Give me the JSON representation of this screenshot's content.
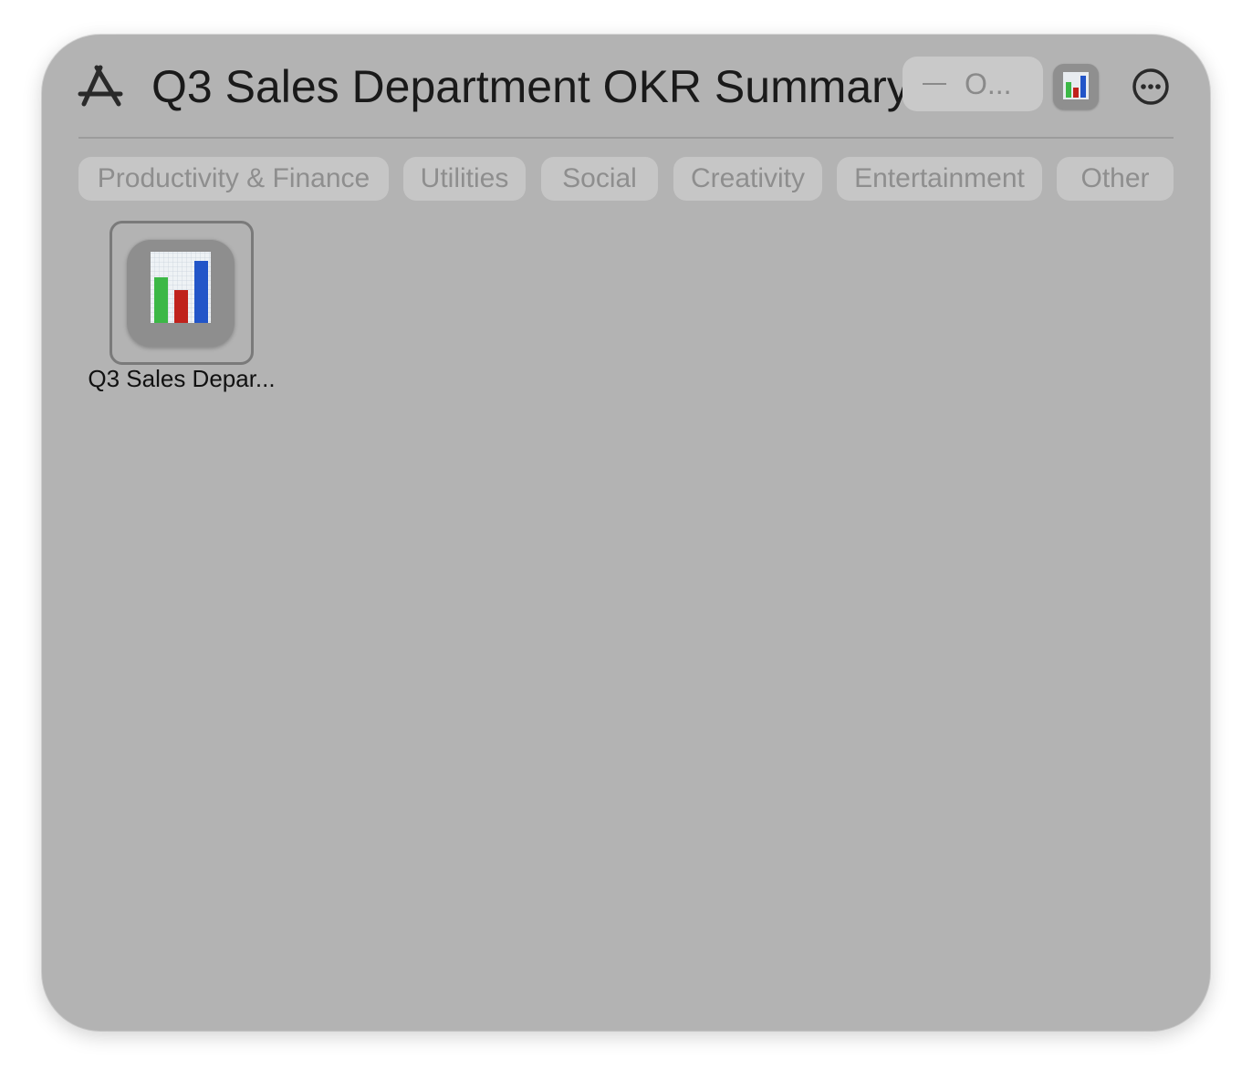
{
  "window": {
    "title": "Q3 Sales Department OKR Summary"
  },
  "header": {
    "app_icon": "app-store-icon",
    "search_text": "O...",
    "widget_icon": "bar-chart-icon",
    "more_icon": "ellipsis-circle-icon"
  },
  "categories": [
    {
      "label": "Productivity & Finance"
    },
    {
      "label": "Utilities"
    },
    {
      "label": "Social"
    },
    {
      "label": "Creativity"
    },
    {
      "label": "Entertainment"
    },
    {
      "label": "Other"
    }
  ],
  "items": [
    {
      "label": "Q3 Sales Depar...",
      "icon": "bar-chart-icon"
    }
  ],
  "colors": {
    "window_bg": "#b3b3b3",
    "chip_bg": "#c6c6c6",
    "chip_text": "#8e8e8e",
    "bar_green": "#3cb846",
    "bar_red": "#c0221c",
    "bar_blue": "#2255c8"
  }
}
